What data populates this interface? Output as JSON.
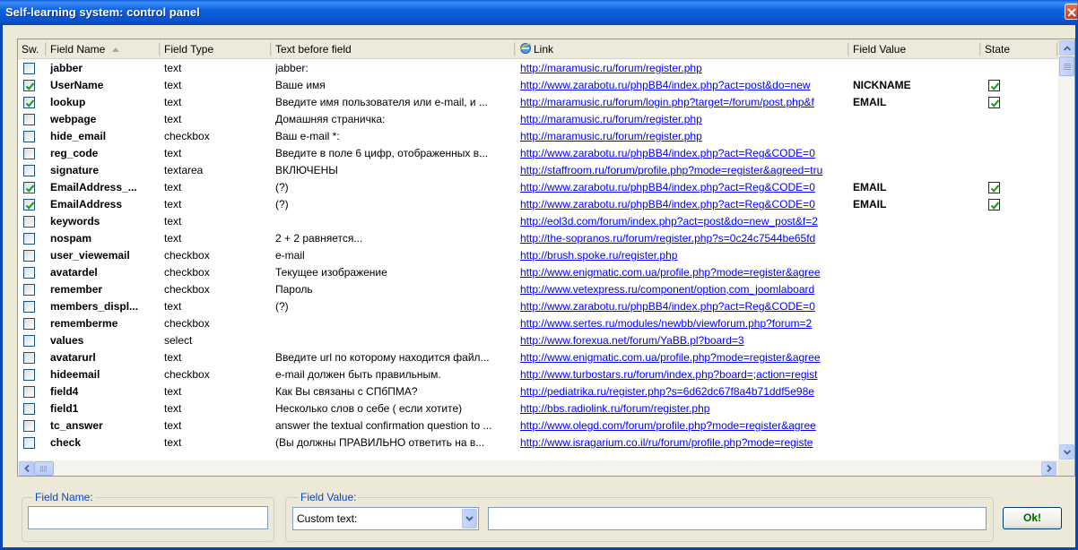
{
  "window": {
    "title": "Self-learning system: control panel"
  },
  "columns": {
    "sw": "Sw.",
    "name": "Field Name",
    "type": "Field Type",
    "text": "Text before field",
    "link": "Link",
    "value": "Field Value",
    "state": "State"
  },
  "rows": [
    {
      "sw": false,
      "name": "jabber",
      "type": "text",
      "text": "jabber:",
      "link": "http://maramusic.ru/forum/register.php",
      "value": "",
      "state": false
    },
    {
      "sw": true,
      "name": "UserName",
      "type": "text",
      "text": "Ваше имя",
      "link": "http://www.zarabotu.ru/phpBB4/index.php?act=post&do=new",
      "value": "NICKNAME",
      "state": true
    },
    {
      "sw": true,
      "name": "lookup",
      "type": "text",
      "text": "Введите имя пользователя или e-mail, и ...",
      "link": "http://maramusic.ru/forum/login.php?target=/forum/post.php&f",
      "value": "EMAIL",
      "state": true
    },
    {
      "sw": false,
      "name": "webpage",
      "type": "text",
      "text": "Домашняя страничка:",
      "link": "http://maramusic.ru/forum/register.php",
      "value": "",
      "state": false
    },
    {
      "sw": false,
      "name": "hide_email",
      "type": "checkbox",
      "text": "Ваш e-mail *:",
      "link": "http://maramusic.ru/forum/register.php",
      "value": "",
      "state": false
    },
    {
      "sw": false,
      "name": "reg_code",
      "type": "text",
      "text": "Введите в поле 6 цифр, отображенных в...",
      "link": "http://www.zarabotu.ru/phpBB4/index.php?act=Reg&CODE=0",
      "value": "",
      "state": false
    },
    {
      "sw": false,
      "name": "signature",
      "type": "textarea",
      "text": "ВКЛЮЧЕНЫ",
      "link": "http://staffroom.ru/forum/profile.php?mode=register&agreed=tru",
      "value": "",
      "state": false
    },
    {
      "sw": true,
      "name": "EmailAddress_...",
      "type": "text",
      "text": "(?)",
      "link": "http://www.zarabotu.ru/phpBB4/index.php?act=Reg&CODE=0",
      "value": "EMAIL",
      "state": true
    },
    {
      "sw": true,
      "name": "EmailAddress",
      "type": "text",
      "text": "(?)",
      "link": "http://www.zarabotu.ru/phpBB4/index.php?act=Reg&CODE=0",
      "value": "EMAIL",
      "state": true
    },
    {
      "sw": false,
      "name": "keywords",
      "type": "text",
      "text": "",
      "link": "http://eol3d.com/forum/index.php?act=post&do=new_post&f=2",
      "value": "",
      "state": false
    },
    {
      "sw": false,
      "name": "nospam",
      "type": "text",
      "text": "2 + 2 равняется...",
      "link": "http://the-sopranos.ru/forum/register.php?s=0c24c7544be65fd",
      "value": "",
      "state": false
    },
    {
      "sw": false,
      "name": "user_viewemail",
      "type": "checkbox",
      "text": "e-mail",
      "link": "http://brush.spoke.ru/register.php",
      "value": "",
      "state": false
    },
    {
      "sw": false,
      "name": "avatardel",
      "type": "checkbox",
      "text": "Текущее изображение",
      "link": "http://www.enigmatic.com.ua/profile.php?mode=register&agree",
      "value": "",
      "state": false
    },
    {
      "sw": false,
      "name": "remember",
      "type": "checkbox",
      "text": "Пароль",
      "link": "http://www.vetexpress.ru/component/option,com_joomlaboard",
      "value": "",
      "state": false
    },
    {
      "sw": false,
      "name": "members_displ...",
      "type": "text",
      "text": "(?)",
      "link": "http://www.zarabotu.ru/phpBB4/index.php?act=Reg&CODE=0",
      "value": "",
      "state": false
    },
    {
      "sw": false,
      "name": "rememberme",
      "type": "checkbox",
      "text": "",
      "link": "http://www.sertes.ru/modules/newbb/viewforum.php?forum=2",
      "value": "",
      "state": false
    },
    {
      "sw": false,
      "name": "values",
      "type": "select",
      "text": "",
      "link": "http://www.forexua.net/forum/YaBB.pl?board=3",
      "value": "",
      "state": false
    },
    {
      "sw": false,
      "name": "avatarurl",
      "type": "text",
      "text": "Введите url по которому находится файл...",
      "link": "http://www.enigmatic.com.ua/profile.php?mode=register&agree",
      "value": "",
      "state": false
    },
    {
      "sw": false,
      "name": "hideemail",
      "type": "checkbox",
      "text": "e-mail должен быть правильным.",
      "link": "http://www.turbostars.ru/forum/index.php?board=;action=regist",
      "value": "",
      "state": false
    },
    {
      "sw": false,
      "name": "field4",
      "type": "text",
      "text": "Как Вы связаны с СПбПМА?",
      "link": "http://pediatrika.ru/register.php?s=6d62dc67f8a4b71ddf5e98e",
      "value": "",
      "state": false
    },
    {
      "sw": false,
      "name": "field1",
      "type": "text",
      "text": "Несколько слов о себе ( если хотите)",
      "link": "http://bbs.radiolink.ru/forum/register.php",
      "value": "",
      "state": false
    },
    {
      "sw": false,
      "name": "tc_answer",
      "type": "text",
      "text": "answer the textual confirmation question to ...",
      "link": "http://www.olegd.com/forum/profile.php?mode=register&agree",
      "value": "",
      "state": false
    },
    {
      "sw": false,
      "name": "check",
      "type": "text",
      "text": "(Вы должны ПРАВИЛЬНО ответить на в...",
      "link": "http://www.isragarium.co.il/ru/forum/profile.php?mode=registe",
      "value": "",
      "state": false
    }
  ],
  "bottom": {
    "field_name_label": "Field Name:",
    "field_name_value": "",
    "field_value_label": "Field Value:",
    "field_value_option": "Custom text:",
    "field_value_text": "",
    "ok_label": "Ok!"
  }
}
